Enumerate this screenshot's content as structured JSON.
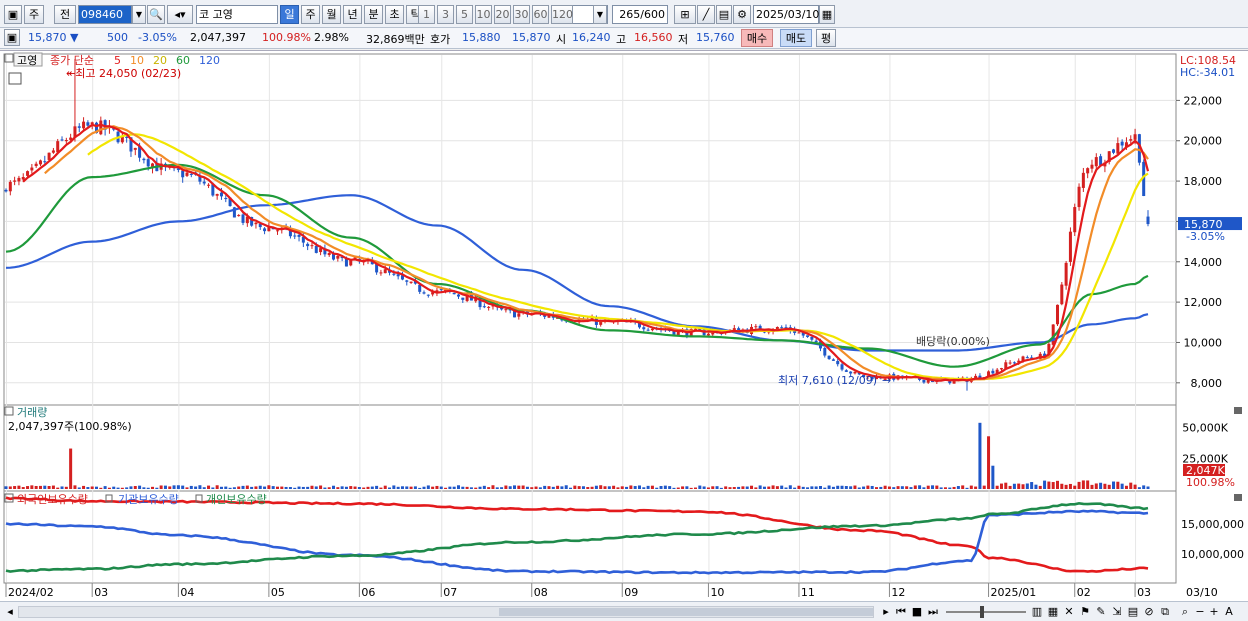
{
  "toolbar": {
    "market_label": "주",
    "scope_label": "전",
    "code_value": "098460",
    "category_label": "코",
    "stock_name": "고영",
    "period_tabs": [
      "일",
      "주",
      "월",
      "년",
      "분",
      "초",
      "틱"
    ],
    "active_period": "일",
    "interval_buttons": [
      "1",
      "3",
      "5",
      "10",
      "20",
      "30",
      "60",
      "120"
    ],
    "range_value": "265",
    "range_total": "/600",
    "date_value": "2025/03/10"
  },
  "quote": {
    "price": "15,870",
    "change": "500",
    "change_pct": "-3.05%",
    "volume": "2,047,397",
    "volume_ratio": "100.98%",
    "turnover_pct": "2.98%",
    "amount": "32,869백만",
    "ask_label": "호가",
    "ask1": "15,880",
    "bid1": "15,870",
    "open_label": "시",
    "open": "16,240",
    "high_label": "고",
    "high": "16,560",
    "low_label": "저",
    "low": "15,760",
    "buy_label": "매수",
    "sell_label": "매도",
    "eval_label": "평"
  },
  "price_panel": {
    "stock_label": "고영",
    "ma_title": "종가 단순",
    "ma_periods": [
      "5",
      "10",
      "20",
      "60",
      "120"
    ],
    "ma_colors": [
      "#e31a1c",
      "#f28c28",
      "#f2e600",
      "#1f9a3b",
      "#2f5fd8"
    ],
    "high_note": "최고 24,050 (02/23)",
    "low_note": "최저 7,610 (12/09)",
    "dividend_note": "배당락(0.00%)",
    "lc_label": "LC:108.54",
    "hc_label": "HC:-34.01",
    "current_price_tag": "15,870",
    "current_change_tag": "-3.05%"
  },
  "volume_panel": {
    "title": "거래량",
    "info": "2,047,397주(100.98%)",
    "current_tag": "2,047K",
    "current_pct_tag": "100.98%"
  },
  "holding_panel": {
    "foreign_label": "외국인보유수량",
    "inst_label": "기관보유수량",
    "indiv_label": "개인보유수량"
  },
  "x_axis_labels": [
    "2024/02",
    "03",
    "04",
    "05",
    "06",
    "07",
    "08",
    "09",
    "10",
    "11",
    "12",
    "2025/01",
    "02",
    "03",
    "03/10"
  ],
  "chart_data": [
    {
      "type": "candlestick",
      "title": "고영 일봉",
      "ylim": [
        6900,
        24300
      ],
      "y_ticks": [
        8000,
        10000,
        12000,
        14000,
        16000,
        18000,
        20000,
        22000
      ],
      "anchors_x": [
        0,
        20,
        40,
        60,
        80,
        100,
        120,
        140,
        160,
        180,
        200,
        220,
        240,
        252,
        262,
        265
      ],
      "close_path": [
        17800,
        20700,
        18400,
        15700,
        14000,
        12500,
        11400,
        11000,
        10500,
        10700,
        8300,
        8100,
        9300,
        19000,
        20200,
        16400
      ],
      "ma60_path": [
        14500,
        18200,
        18800,
        17300,
        15200,
        12900,
        11600,
        10600,
        10300,
        10100,
        9700,
        8800,
        9900,
        12400,
        12900,
        13300
      ],
      "ma120_path": [
        13700,
        15000,
        16000,
        16800,
        17300,
        15800,
        13600,
        11800,
        10800,
        10100,
        9600,
        9600,
        10000,
        10900,
        11200,
        11400
      ],
      "high": {
        "value": 24050,
        "date": "02/23"
      },
      "low": {
        "value": 7610,
        "date": "12/09"
      },
      "last": {
        "close": 15870,
        "open": 16240,
        "high": 16560,
        "low": 15760,
        "change_pct": -3.05
      }
    },
    {
      "type": "bar",
      "title": "거래량",
      "y_ticks": [
        25000,
        50000
      ],
      "y_tick_labels": [
        "25,000K",
        "50,000K"
      ],
      "ylim": [
        0,
        62000
      ],
      "spikes": [
        {
          "x": 15,
          "value": 33000
        },
        {
          "x": 226,
          "value": 54000
        },
        {
          "x": 228,
          "value": 43000
        },
        {
          "x": 229,
          "value": 19000
        }
      ],
      "last": 2047
    },
    {
      "type": "line",
      "title": "보유수량",
      "y_ticks": [
        10000000,
        15000000
      ],
      "y_tick_labels": [
        "10,000,000",
        "15,000,000"
      ],
      "ylim": [
        5500000,
        19500000
      ],
      "series": [
        {
          "name": "외국인보유수량",
          "color": "#e31a1c",
          "x": [
            0,
            20,
            40,
            80,
            120,
            160,
            200,
            224,
            228,
            250,
            265
          ],
          "values": [
            19300000,
            18800000,
            18700000,
            18400000,
            17500000,
            17100000,
            13900000,
            11300000,
            9400000,
            7100000,
            7600000
          ]
        },
        {
          "name": "기관보유수량",
          "color": "#2f5fd8",
          "x": [
            0,
            20,
            40,
            80,
            120,
            160,
            200,
            224,
            228,
            250,
            265
          ],
          "values": [
            15000000,
            14600000,
            13100000,
            9800000,
            7100000,
            6900000,
            7000000,
            8900000,
            16500000,
            17100000,
            16800000
          ]
        },
        {
          "name": "개인보유수량",
          "color": "#1f8a4b",
          "x": [
            0,
            20,
            40,
            80,
            120,
            160,
            200,
            224,
            228,
            250,
            265
          ],
          "values": [
            7200000,
            7500000,
            8300000,
            9700000,
            12000000,
            13300000,
            14700000,
            15900000,
            16600000,
            18400000,
            17600000
          ]
        }
      ]
    }
  ]
}
